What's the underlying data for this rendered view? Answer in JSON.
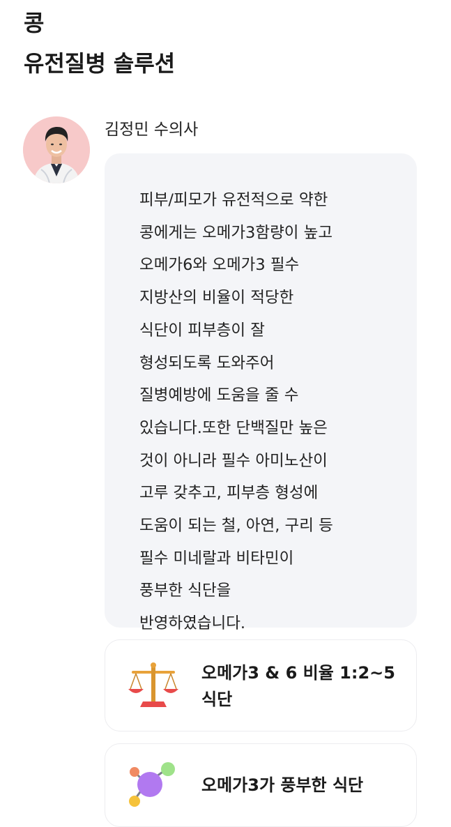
{
  "header": {
    "pet_name": "콩",
    "title": "유전질병 솔루션"
  },
  "vet": {
    "name": "김정민 수의사",
    "avatar_icon": "vet-portrait"
  },
  "message": {
    "lines": [
      "피부/피모가 유전적으로 약한",
      "콩에게는 오메가3함량이 높고",
      "오메가6와 오메가3 필수",
      "지방산의 비율이 적당한",
      "식단이 피부층이 잘",
      "형성되도록 도와주어",
      "질병예방에 도움을 줄 수",
      "있습니다.또한 단백질만 높은",
      "것이 아니라 필수 아미노산이",
      "고루 갖추고, 피부층 형성에",
      "도움이 되는 철, 아연, 구리 등",
      "필수 미네랄과 비타민이",
      "풍부한 식단을",
      "반영하였습니다."
    ]
  },
  "solutions": [
    {
      "icon": "balance-scale-icon",
      "label": "오메가3 & 6 비율 1:2~5 식단"
    },
    {
      "icon": "molecule-icon",
      "label": "오메가3가 풍부한 식단"
    }
  ],
  "colors": {
    "bubble_bg": "#f4f5f8",
    "avatar_bg": "#f7c9c9"
  }
}
